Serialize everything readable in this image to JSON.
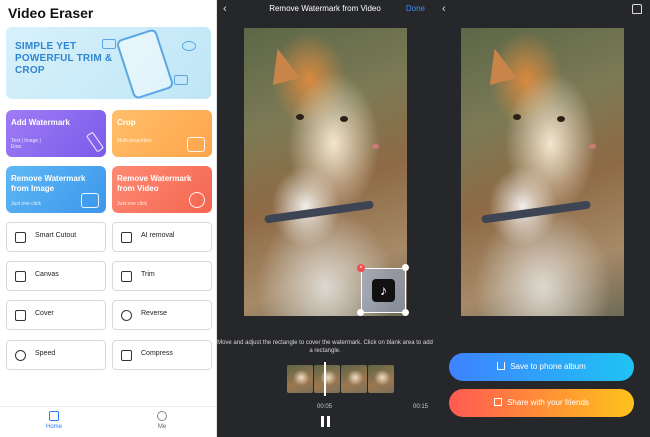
{
  "home": {
    "app_title": "Video Eraser",
    "banner_text": "SIMPLE YET POWERFUL TRIM & CROP",
    "feature_cards": [
      {
        "title": "Add Watermark",
        "subtitle": "Text | Image | Emo",
        "icon": "pencil-icon"
      },
      {
        "title": "Crop",
        "subtitle": "Multi-proportion",
        "icon": "crop-play-icon"
      },
      {
        "title": "Remove Watermark from Image",
        "subtitle": "Just one click",
        "icon": "image-icon"
      },
      {
        "title": "Remove Watermark from Video",
        "subtitle": "Just one click",
        "icon": "film-reel-icon"
      }
    ],
    "tools": [
      {
        "label": "Smart Cutout",
        "icon": "cutout-icon"
      },
      {
        "label": "AI removal",
        "icon": "eraser-icon"
      },
      {
        "label": "Canvas",
        "icon": "canvas-icon"
      },
      {
        "label": "Trim",
        "icon": "trim-icon"
      },
      {
        "label": "Cover",
        "icon": "book-icon"
      },
      {
        "label": "Reverse",
        "icon": "reverse-icon"
      },
      {
        "label": "Speed",
        "icon": "speedometer-icon"
      },
      {
        "label": "Compress",
        "icon": "compress-icon"
      }
    ],
    "nav": [
      {
        "label": "Home",
        "active": true,
        "icon": "home-icon"
      },
      {
        "label": "Me",
        "active": false,
        "icon": "user-icon"
      }
    ]
  },
  "editor": {
    "title": "Remove Watermark from Video",
    "done_label": "Done",
    "watermark_logo": "♪",
    "hint": "Move and adjust the rectangle to cover the watermark. Click on blank area to add a rectangle.",
    "current_time": "00:05",
    "total_time": "00:15"
  },
  "result": {
    "save_label": "Save to phone album",
    "share_label": "Share with your friends"
  },
  "colors": {
    "accent_blue": "#3b8cff",
    "dark_bg": "#26272b",
    "card_purple": "#8c6cf1",
    "card_orange": "#ffb25d",
    "card_blue": "#4aa6f1",
    "card_red": "#f8775f"
  }
}
